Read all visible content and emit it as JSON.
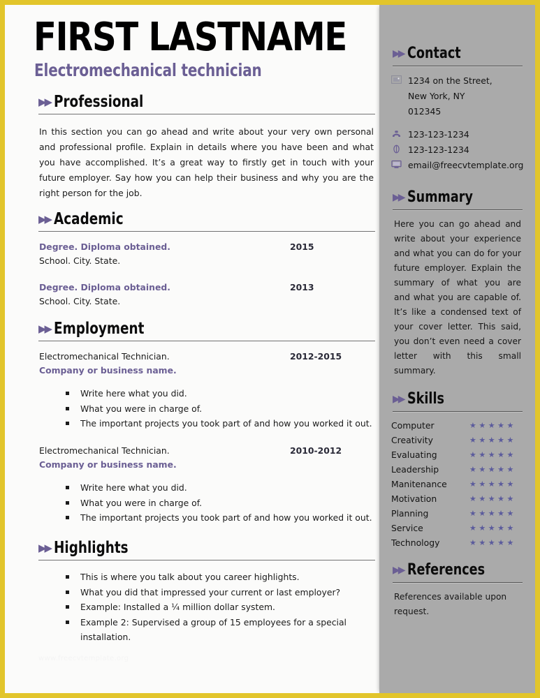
{
  "theme": {
    "border_color": "#e2c52b",
    "sidebar_bg": "#aaaaaa",
    "page_bg": "#fbfbfa",
    "accent_purple": "#6b5f94",
    "star_color": "#5b5b9c",
    "heading_color": "#0c0c0c"
  },
  "header": {
    "name": "FIRST LASTNAME",
    "job_title": "Electromechanical technician"
  },
  "arrows_glyph": "▶▶",
  "main": {
    "professional": {
      "heading": "Professional",
      "body": "In this section you can go ahead and write about your very own personal and professional profile. Explain in details where you have been and what you have accomplished. It’s a great way to firstly get in touch with your future employer. Say how you can help their business and why you are the right person for the job."
    },
    "academic": {
      "heading": "Academic",
      "entries": [
        {
          "degree": "Degree. Diploma obtained.",
          "year": "2015",
          "school": "School. City. State."
        },
        {
          "degree": "Degree. Diploma obtained.",
          "year": "2013",
          "school": "School. City. State."
        }
      ]
    },
    "employment": {
      "heading": "Employment",
      "entries": [
        {
          "title": "Electromechanical Technician.",
          "period": "2012-2015",
          "company": "Company or business name.",
          "bullets": [
            "Write here what you did.",
            "What you were in charge of.",
            "The important projects you took part of and how you worked it out."
          ]
        },
        {
          "title": "Electromechanical Technician.",
          "period": "2010-2012",
          "company": "Company or business name.",
          "bullets": [
            "Write here what you did.",
            "What you were in charge of.",
            "The important projects you took part of and how you worked it out."
          ]
        }
      ]
    },
    "highlights": {
      "heading": "Highlights",
      "bullets": [
        "This is where you talk about you career highlights.",
        "What you did that impressed your current or last employer?",
        "Example: Installed a ¼ million dollar system.",
        "Example 2: Supervised a group of 15 employees for a special installation."
      ]
    },
    "watermark": "www.freecvtemplate.org"
  },
  "sidebar": {
    "contact": {
      "heading": "Contact",
      "address": {
        "icon": "address-card-icon",
        "line1": "1234 on the Street,",
        "line2": "New York, NY",
        "line3": "012345"
      },
      "phone": {
        "icon": "telephone-icon",
        "value": "123-123-1234"
      },
      "mobile": {
        "icon": "mobile-phone-icon",
        "value": "123-123-1234"
      },
      "email": {
        "icon": "monitor-icon",
        "value": "email@freecvtemplate.org"
      }
    },
    "summary": {
      "heading": "Summary",
      "body": "Here you can go ahead and write about your experience and what you can do for your future employer. Explain the summary of what you are and what you are capable of. It’s like a condensed text of your cover letter. This said, you don’t even need a cover letter with this small summary."
    },
    "skills": {
      "heading": "Skills",
      "max_stars": 5,
      "items": [
        {
          "name": "Computer",
          "rating": 5
        },
        {
          "name": "Creativity",
          "rating": 5
        },
        {
          "name": "Evaluating",
          "rating": 5
        },
        {
          "name": "Leadership",
          "rating": 5
        },
        {
          "name": "Manitenance",
          "rating": 5
        },
        {
          "name": "Motivation",
          "rating": 5
        },
        {
          "name": "Planning",
          "rating": 5
        },
        {
          "name": "Service",
          "rating": 5
        },
        {
          "name": "Technology",
          "rating": 5
        }
      ]
    },
    "references": {
      "heading": "References",
      "body": "References available upon request."
    }
  }
}
